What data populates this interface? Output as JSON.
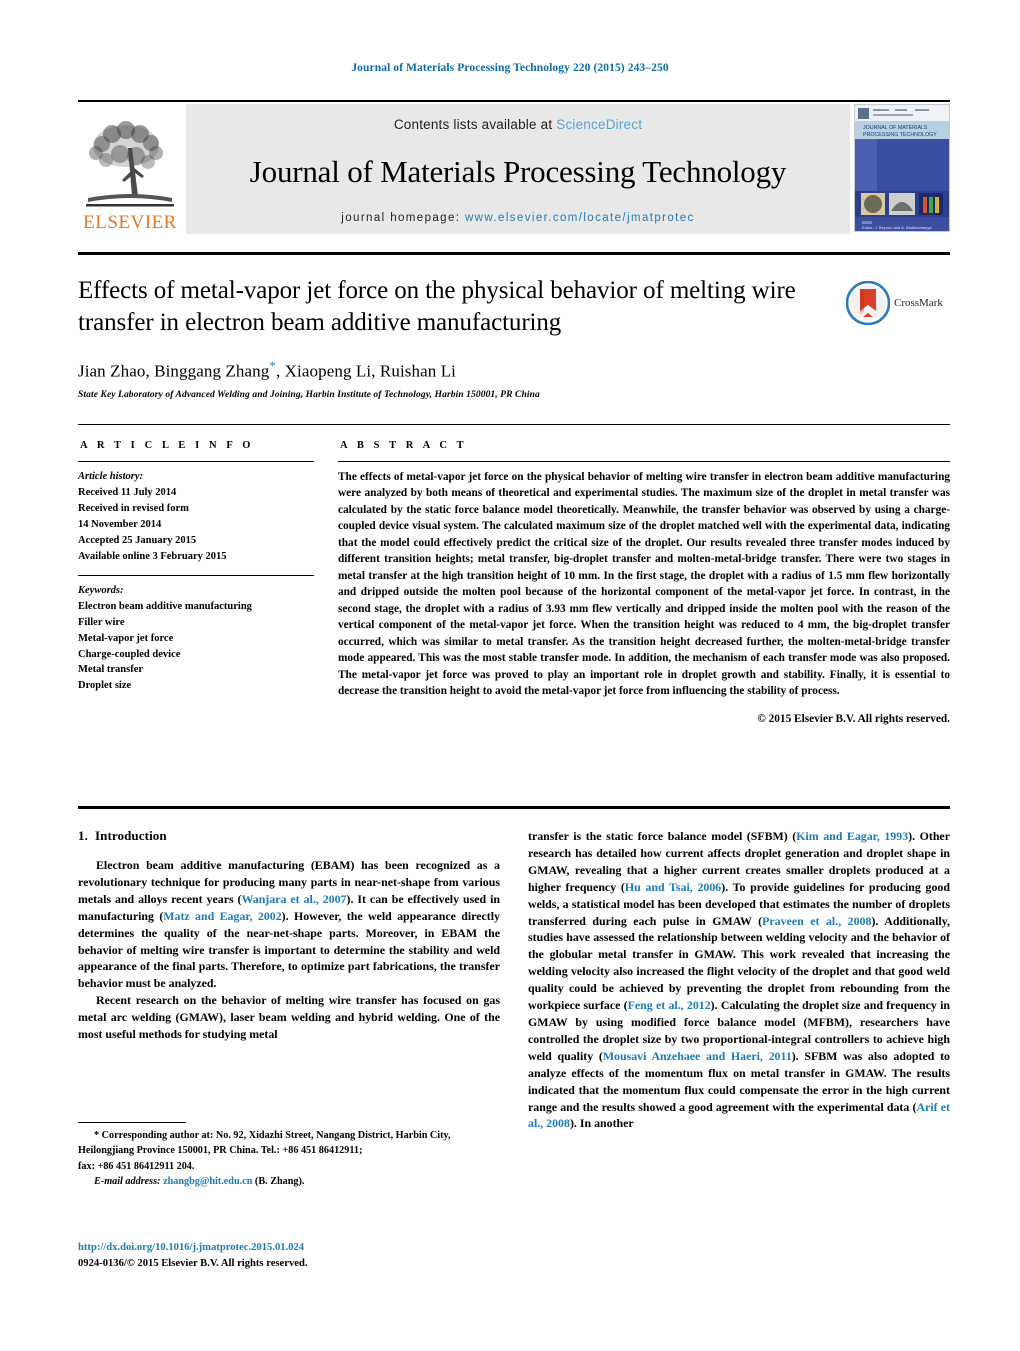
{
  "running_head": "Journal of Materials Processing Technology 220 (2015) 243–250",
  "masthead": {
    "publisher_logo_text": "ELSEVIER",
    "contents_prefix": "Contents lists available at ",
    "contents_link": "ScienceDirect",
    "journal_title": "Journal of Materials Processing Technology",
    "homepage_prefix": "journal homepage: ",
    "homepage_url": "www.elsevier.com/locate/jmatprotec",
    "cover_lines": {
      "line1": "JOURNAL OF MATERIALS",
      "line2": "PROCESSING TECHNOLOGY",
      "footer": "Editor: J. Beynon and A. Bhattacharyya"
    }
  },
  "article": {
    "title": "Effects of metal-vapor jet force on the physical behavior of melting wire transfer in electron beam additive manufacturing",
    "authors": "Jian Zhao, Binggang Zhang",
    "authors_tail": ", Xiaopeng Li, Ruishan Li",
    "corresponding_marker": "*",
    "affiliation": "State Key Laboratory of Advanced Welding and Joining, Harbin Institute of Technology, Harbin 150001, PR China",
    "crossmark_label": "CrossMark"
  },
  "article_info": {
    "heading": "A R T I C L E   I N F O",
    "history_label": "Article history:",
    "history": [
      "Received 11 July 2014",
      "Received in revised form",
      "14 November 2014",
      "Accepted 25 January 2015",
      "Available online 3 February 2015"
    ],
    "keywords_label": "Keywords:",
    "keywords": [
      "Electron beam additive manufacturing",
      "Filler wire",
      "Metal-vapor jet force",
      "Charge-coupled device",
      "Metal transfer",
      "Droplet size"
    ]
  },
  "abstract": {
    "heading": "A B S T R A C T",
    "text": "The effects of metal-vapor jet force on the physical behavior of melting wire transfer in electron beam additive manufacturing were analyzed by both means of theoretical and experimental studies. The maximum size of the droplet in metal transfer was calculated by the static force balance model theoretically. Meanwhile, the transfer behavior was observed by using a charge-coupled device visual system. The calculated maximum size of the droplet matched well with the experimental data, indicating that the model could effectively predict the critical size of the droplet. Our results revealed three transfer modes induced by different transition heights; metal transfer, big-droplet transfer and molten-metal-bridge transfer. There were two stages in metal transfer at the high transition height of 10 mm. In the first stage, the droplet with a radius of 1.5 mm flew horizontally and dripped outside the molten pool because of the horizontal component of the metal-vapor jet force. In contrast, in the second stage, the droplet with a radius of 3.93 mm flew vertically and dripped inside the molten pool with the reason of the vertical component of the metal-vapor jet force. When the transition height was reduced to 4 mm, the big-droplet transfer occurred, which was similar to metal transfer. As the transition height decreased further, the molten-metal-bridge transfer mode appeared. This was the most stable transfer mode. In addition, the mechanism of each transfer mode was also proposed. The metal-vapor jet force was proved to play an important role in droplet growth and stability. Finally, it is essential to decrease the transition height to avoid the metal-vapor jet force from influencing the stability of process.",
    "copyright": "© 2015 Elsevier B.V. All rights reserved."
  },
  "body": {
    "section_number": "1.",
    "section_title": "Introduction",
    "left_para_1_a": "Electron beam additive manufacturing (EBAM) has been recognized as a revolutionary technique for producing many parts in near-net-shape from various metals and alloys recent years (",
    "left_ref_1": "Wanjara et al., 2007",
    "left_para_1_b": "). It can be effectively used in manufacturing (",
    "left_ref_2": "Matz and Eagar, 2002",
    "left_para_1_c": "). However, the weld appearance directly determines the quality of the near-net-shape parts. Moreover, in EBAM the behavior of melting wire transfer is important to determine the stability and weld appearance of the final parts. Therefore, to optimize part fabrications, the transfer behavior must be analyzed.",
    "left_para_2": "Recent research on the behavior of melting wire transfer has focused on gas metal arc welding (GMAW), laser beam welding and hybrid welding. One of the most useful methods for studying metal",
    "right_a": "transfer is the static force balance model (SFBM) (",
    "right_ref_1": "Kim and Eagar, 1993",
    "right_b": "). Other research has detailed how current affects droplet generation and droplet shape in GMAW, revealing that a higher current creates smaller droplets produced at a higher frequency (",
    "right_ref_2": "Hu and Tsai, 2006",
    "right_c": "). To provide guidelines for producing good welds, a statistical model has been developed that estimates the number of droplets transferred during each pulse in GMAW (",
    "right_ref_3": "Praveen et al., 2008",
    "right_d": "). Additionally, studies have assessed the relationship between welding velocity and the behavior of the globular metal transfer in GMAW. This work revealed that increasing the welding velocity also increased the flight velocity of the droplet and that good weld quality could be achieved by preventing the droplet from rebounding from the workpiece surface (",
    "right_ref_4": "Feng et al., 2012",
    "right_e": "). Calculating the droplet size and frequency in GMAW by using modified force balance model (MFBM), researchers have controlled the droplet size by two proportional-integral controllers to achieve high weld quality (",
    "right_ref_5": "Mousavi Anzehaee and Haeri, 2011",
    "right_f": "). SFBM was also adopted to analyze effects of the momentum flux on metal transfer in GMAW. The results indicated that the momentum flux could compensate the error in the high current range and the results showed a good agreement with the experimental data (",
    "right_ref_6": "Arif et al., 2008",
    "right_g": "). In another"
  },
  "footnote": {
    "line1": "* Corresponding author at: No. 92, Xidazhi Street, Nangang District, Harbin City, Heilongjiang Province 150001, PR China. Tel.: +86 451 86412911;",
    "line2": "fax: +86 451 86412911 204.",
    "email_label": "E-mail address:",
    "email": "zhangbg@hit.edu.cn",
    "email_author": "(B. Zhang)."
  },
  "doi_block": {
    "doi": "http://dx.doi.org/10.1016/j.jmatprotec.2015.01.024",
    "issn_line": "0924-0136/© 2015 Elsevier B.V. All rights reserved."
  },
  "colors": {
    "link_blue": "#1a7bb9",
    "header_blue": "#0b6ca8",
    "sciencedirect_blue": "#5ba3d0",
    "elsevier_orange": "#e87722",
    "masthead_grey": "#e8e8e8",
    "crossmark_red": "#d8402a",
    "crossmark_blue": "#2b7cb8"
  }
}
